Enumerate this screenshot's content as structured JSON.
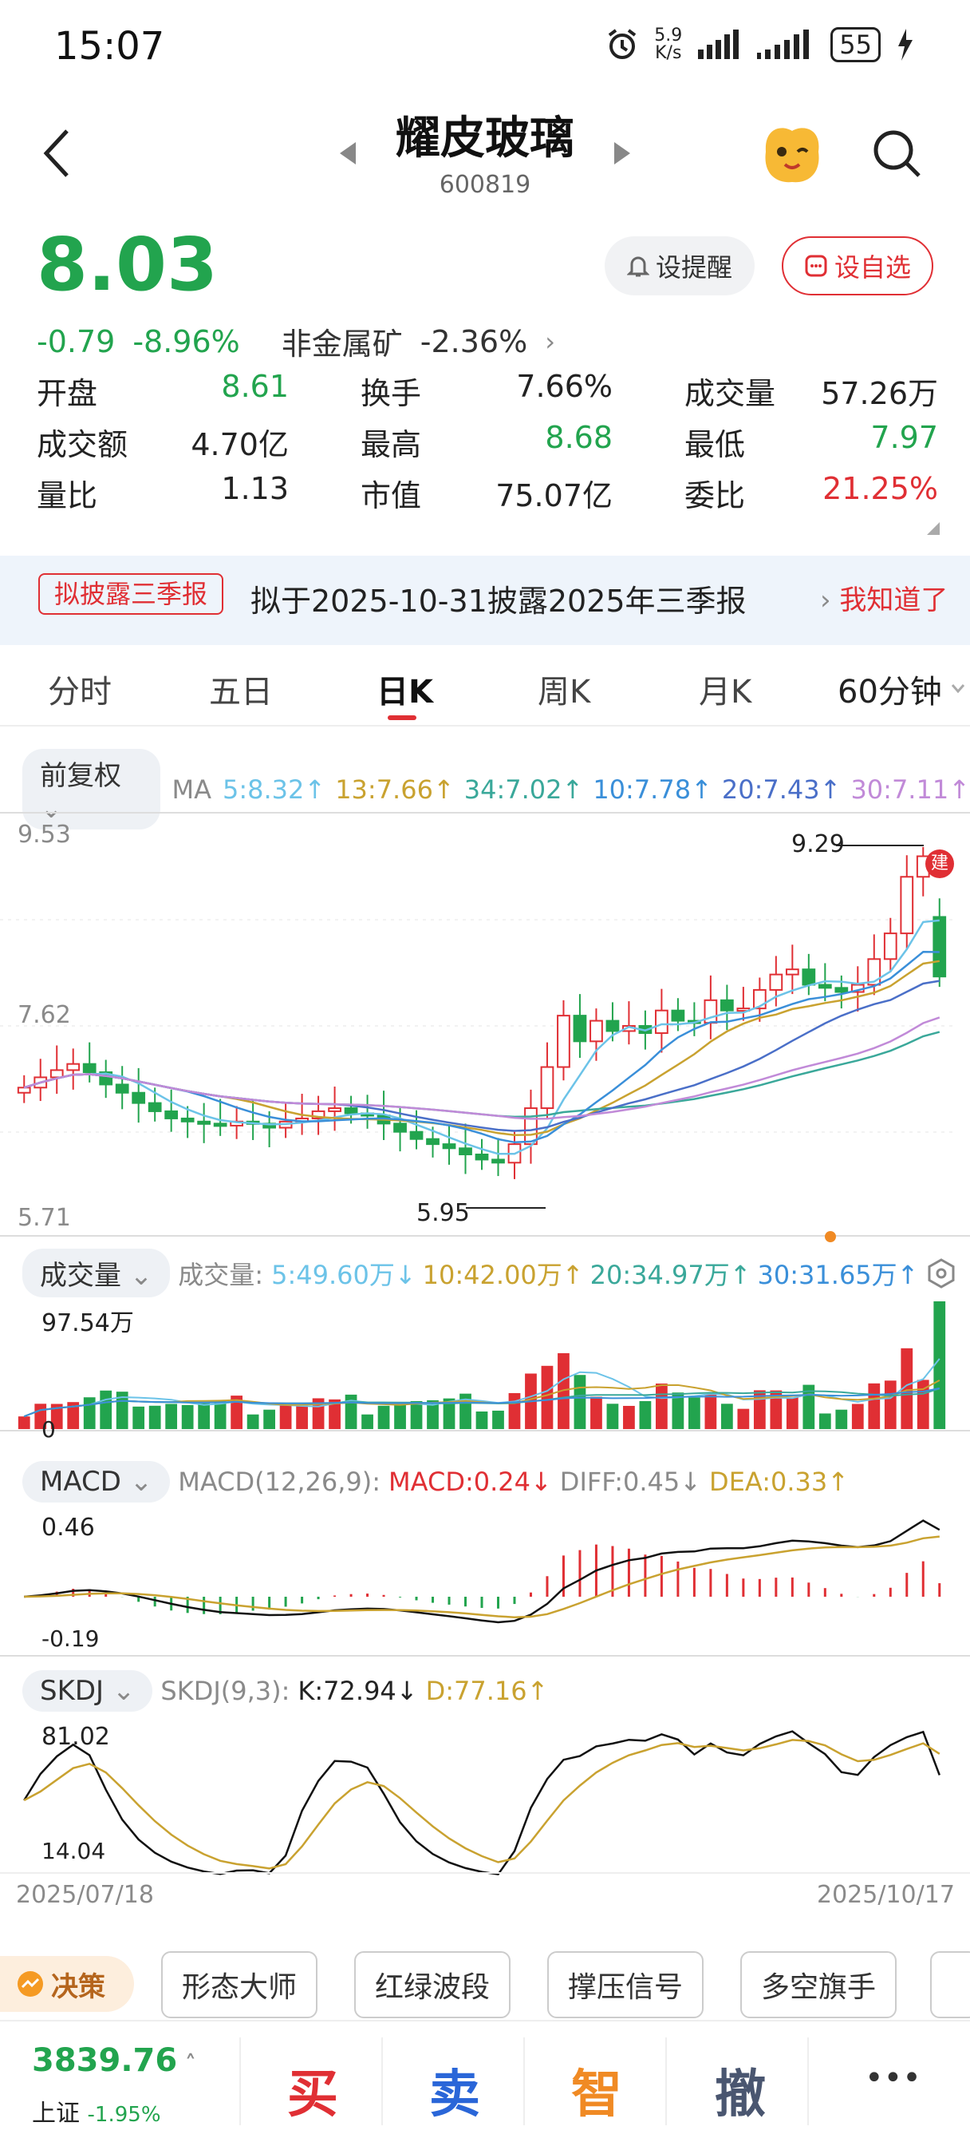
{
  "status_bar": {
    "time": "15:07",
    "net_speed_top": "5.9",
    "net_speed_unit": "K/s",
    "battery": "55"
  },
  "header": {
    "stock_name": "耀皮玻璃",
    "stock_code": "600819"
  },
  "quote": {
    "price": "8.03",
    "change": "-0.79",
    "change_pct": "-8.96%",
    "sector": "非金属矿",
    "sector_pct": "-2.36%",
    "alert_label": "设提醒",
    "watch_label": "设自选"
  },
  "stats": [
    {
      "label": "开盘",
      "value": "8.61",
      "color": "#22a44e"
    },
    {
      "label": "换手",
      "value": "7.66%",
      "color": "#222222"
    },
    {
      "label": "成交量",
      "value": "57.26万",
      "color": "#222222"
    },
    {
      "label": "成交额",
      "value": "4.70亿",
      "color": "#222222"
    },
    {
      "label": "最高",
      "value": "8.68",
      "color": "#22a44e"
    },
    {
      "label": "最低",
      "value": "7.97",
      "color": "#22a44e"
    },
    {
      "label": "量比",
      "value": "1.13",
      "color": "#222222"
    },
    {
      "label": "市值",
      "value": "75.07亿",
      "color": "#222222"
    },
    {
      "label": "委比",
      "value": "21.25%",
      "color": "#e02f34"
    }
  ],
  "banner": {
    "tag": "拟披露三季报",
    "text": "拟于2025-10-31披露2025年三季报",
    "action": "我知道了"
  },
  "tabs": [
    "分时",
    "五日",
    "日K",
    "周K",
    "月K",
    "60分钟"
  ],
  "active_tab": "日K",
  "ma": {
    "adjust": "前复权",
    "label": "MA",
    "items": [
      {
        "text": "5:8.32↑",
        "color": "#6cc3e8"
      },
      {
        "text": "13:7.66↑",
        "color": "#c9a230"
      },
      {
        "text": "34:7.02↑",
        "color": "#3aa89a"
      },
      {
        "text": "10:7.78↑",
        "color": "#3a8fd9"
      },
      {
        "text": "20:7.43↑",
        "color": "#4a6fc8"
      },
      {
        "text": "30:7.11↑",
        "color": "#c18ad8"
      }
    ]
  },
  "kline": {
    "y_top": "9.53",
    "y_mid": "7.62",
    "y_bot": "5.71",
    "high_label": "9.29",
    "low_label": "5.95",
    "build_tag": "建"
  },
  "volume": {
    "selector": "成交量",
    "label": "成交量:",
    "items": [
      {
        "text": "5:49.60万↓",
        "color": "#6cc3e8"
      },
      {
        "text": "10:42.00万↑",
        "color": "#c9a230"
      },
      {
        "text": "20:34.97万↑",
        "color": "#3aa89a"
      },
      {
        "text": "30:31.65万↑",
        "color": "#3a8fd9"
      }
    ],
    "y_top": "97.54万",
    "y_bot": "0"
  },
  "macd": {
    "selector": "MACD",
    "params": "MACD(12,26,9):",
    "macd": "MACD:0.24↓",
    "diff": "DIFF:0.45↓",
    "dea": "DEA:0.33↑",
    "y_top": "0.46",
    "y_bot": "-0.19"
  },
  "skdj": {
    "selector": "SKDJ",
    "params": "SKDJ(9,3):",
    "k": "K:72.94↓",
    "d": "D:77.16↑",
    "y_top": "81.02",
    "y_bot": "14.04",
    "date_start": "2025/07/18",
    "date_end": "2025/10/17"
  },
  "tools": {
    "decision": "决策",
    "items": [
      "形态大师",
      "红绿波段",
      "撑压信号",
      "多空旗手"
    ]
  },
  "footer": {
    "index_value": "3839.76",
    "index_name": "上证",
    "index_pct": "-1.95%",
    "buy": "买",
    "sell": "卖",
    "smart": "智",
    "cancel": "撤",
    "more": "•••"
  },
  "chart_data": {
    "type": "candlestick",
    "close_series": [
      6.95,
      7.05,
      7.12,
      7.18,
      7.1,
      6.98,
      6.9,
      6.8,
      6.72,
      6.65,
      6.62,
      6.6,
      6.58,
      6.62,
      6.6,
      6.56,
      6.62,
      6.65,
      6.72,
      6.75,
      6.7,
      6.68,
      6.6,
      6.52,
      6.45,
      6.4,
      6.36,
      6.3,
      6.25,
      6.22,
      6.4,
      6.75,
      7.15,
      7.65,
      7.4,
      7.6,
      7.5,
      7.55,
      7.48,
      7.7,
      7.6,
      7.58,
      7.8,
      7.7,
      7.72,
      7.9,
      8.05,
      8.1,
      7.95,
      7.92,
      7.88,
      7.95,
      8.2,
      8.45,
      9.0,
      9.2,
      8.03
    ],
    "high": 9.29,
    "low": 5.95
  }
}
